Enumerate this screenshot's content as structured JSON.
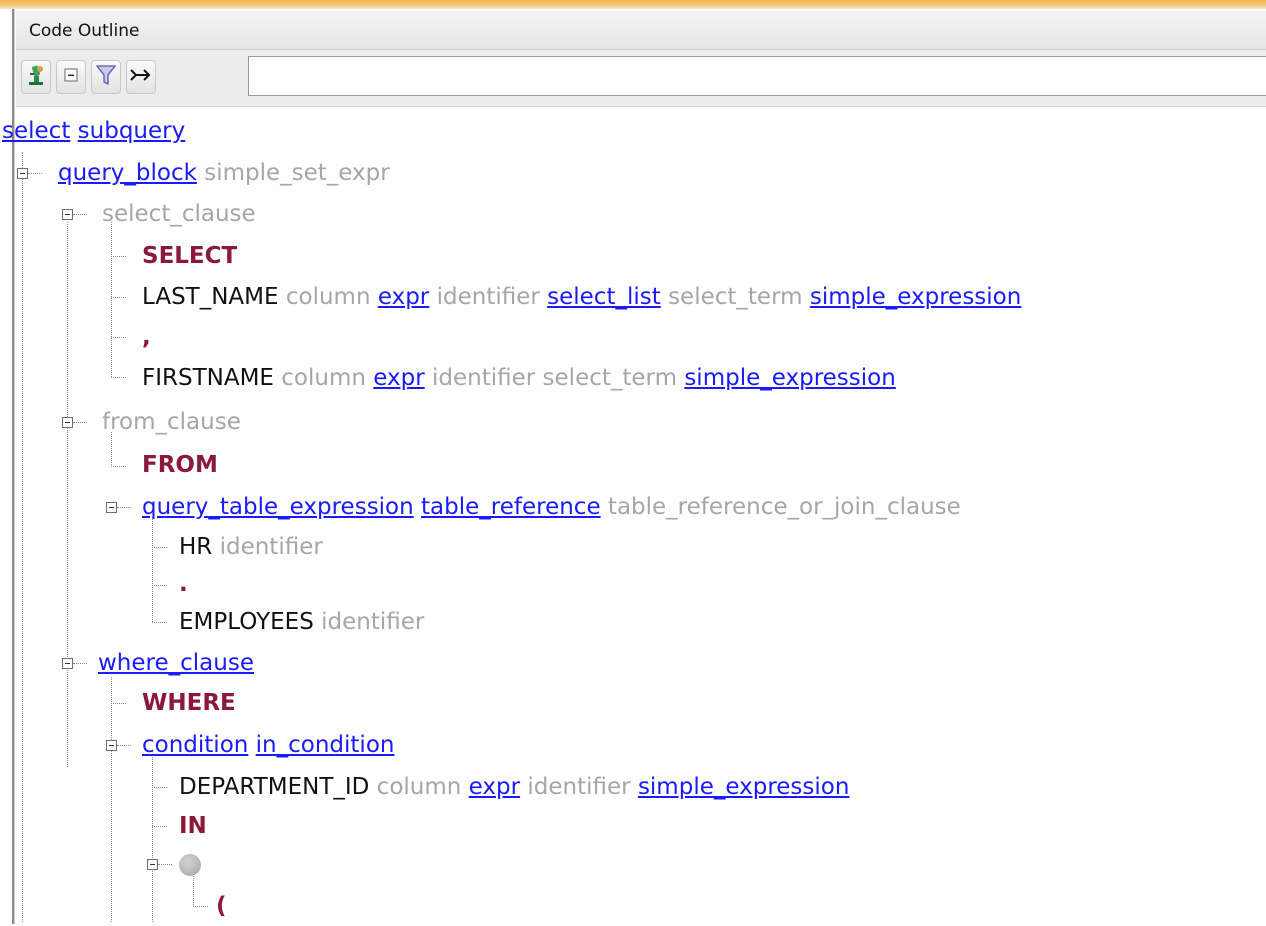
{
  "panel": {
    "title": "Code Outline"
  },
  "toolbar": {
    "buttons": [
      {
        "name": "microscope-icon",
        "glyph": ""
      },
      {
        "name": "collapse-icon",
        "glyph": "⊟"
      },
      {
        "name": "filter-icon",
        "glyph": ""
      },
      {
        "name": "follow-icon",
        "glyph": "⤐"
      }
    ],
    "filter_value": "",
    "filter_placeholder": ""
  },
  "colors": {
    "link": "#1a1aff",
    "keyword": "#8b1a3a",
    "annotation": "#a6a6a6",
    "accent": "#f6b64a"
  },
  "tree": {
    "root": {
      "items": [
        "select",
        "subquery"
      ]
    },
    "query_block": {
      "link": "query_block",
      "extra": "simple_set_expr"
    },
    "select_clause": {
      "label": "select_clause",
      "select_kw": "SELECT",
      "last_name": {
        "name": "LAST_NAME",
        "a1": "column",
        "l1": "expr",
        "a2": "identifier",
        "l2": "select_list",
        "a3": "select_term",
        "l3": "simple_expression"
      },
      "comma": ",",
      "firstname": {
        "name": "FIRSTNAME",
        "a1": "column",
        "l1": "expr",
        "a2": "identifier",
        "a3": "select_term",
        "l3": "simple_expression"
      }
    },
    "from_clause": {
      "label": "from_clause",
      "from_kw": "FROM",
      "qte": {
        "l1": "query_table_expression",
        "l2": "table_reference",
        "a1": "table_reference_or_join_clause"
      },
      "hr": {
        "name": "HR",
        "a1": "identifier"
      },
      "period": ".",
      "employees": {
        "name": "EMPLOYEES",
        "a1": "identifier"
      }
    },
    "where_clause": {
      "label": "where_clause",
      "where_kw": "WHERE",
      "condition": {
        "l1": "condition",
        "l2": "in_condition"
      },
      "department": {
        "name": "DEPARTMENT_ID",
        "a1": "column",
        "l1": "expr",
        "a2": "identifier",
        "l2": "simple_expression"
      },
      "in_kw": "IN",
      "paren": "("
    }
  }
}
